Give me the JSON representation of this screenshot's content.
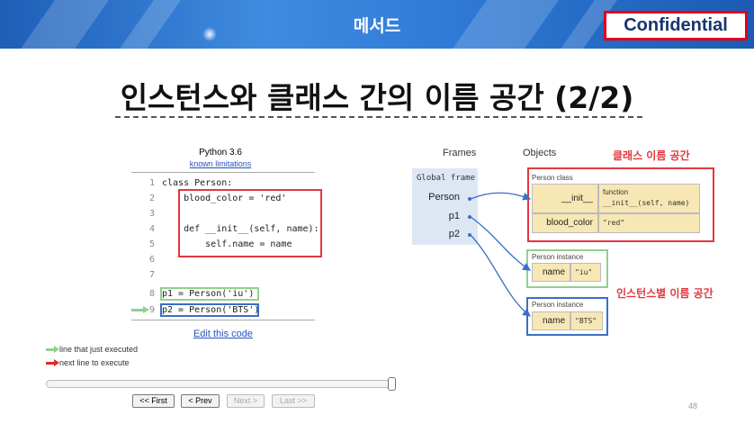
{
  "header": {
    "title": "메서드",
    "confidential": "Confidential"
  },
  "slide": {
    "title": "인스턴스와 클래스 간의 이름 공간 (2/2)",
    "page_number": "48"
  },
  "code_panel": {
    "version": "Python 3.6",
    "limitations_link": "known limitations",
    "lines": [
      {
        "num": "1",
        "text": "class Person:"
      },
      {
        "num": "2",
        "text": "    blood_color = 'red'"
      },
      {
        "num": "3",
        "text": ""
      },
      {
        "num": "4",
        "text": "    def __init__(self, name):"
      },
      {
        "num": "5",
        "text": "        self.name = name"
      },
      {
        "num": "6",
        "text": ""
      },
      {
        "num": "7",
        "text": ""
      },
      {
        "num": "8",
        "text": "p1 = Person('iu')"
      },
      {
        "num": "9",
        "text": "p2 = Person('BTS')"
      }
    ],
    "edit_link": "Edit this code",
    "legend_executed": "line that just executed",
    "legend_next": "next line to execute",
    "nav": {
      "first": "<< First",
      "prev": "< Prev",
      "next": "Next >",
      "last": "Last >>"
    }
  },
  "visualization": {
    "frames_header": "Frames",
    "objects_header": "Objects",
    "global_frame": "Global frame",
    "variables": [
      "Person",
      "p1",
      "p2"
    ],
    "class_namespace_label": "클래스 이름 공간",
    "instance_namespace_label": "인스턴스별 이름 공간",
    "person_class": {
      "title": "Person class",
      "rows": [
        {
          "key": "__init__",
          "value_line1": "function",
          "value_line2": "__init__(self, name)"
        },
        {
          "key": "blood_color",
          "value_line1": "\"red\"",
          "value_line2": ""
        }
      ]
    },
    "instances": [
      {
        "title": "Person instance",
        "key": "name",
        "value": "\"iu\""
      },
      {
        "title": "Person instance",
        "key": "name",
        "value": "\"BTS\""
      }
    ]
  },
  "colors": {
    "banner": "#2f7ad6",
    "highlight_red": "#e2373f",
    "highlight_green": "#8fd18f",
    "highlight_blue": "#3a6fc7",
    "object_fill": "#f7e7b4",
    "frame_fill": "#dde7f4"
  }
}
